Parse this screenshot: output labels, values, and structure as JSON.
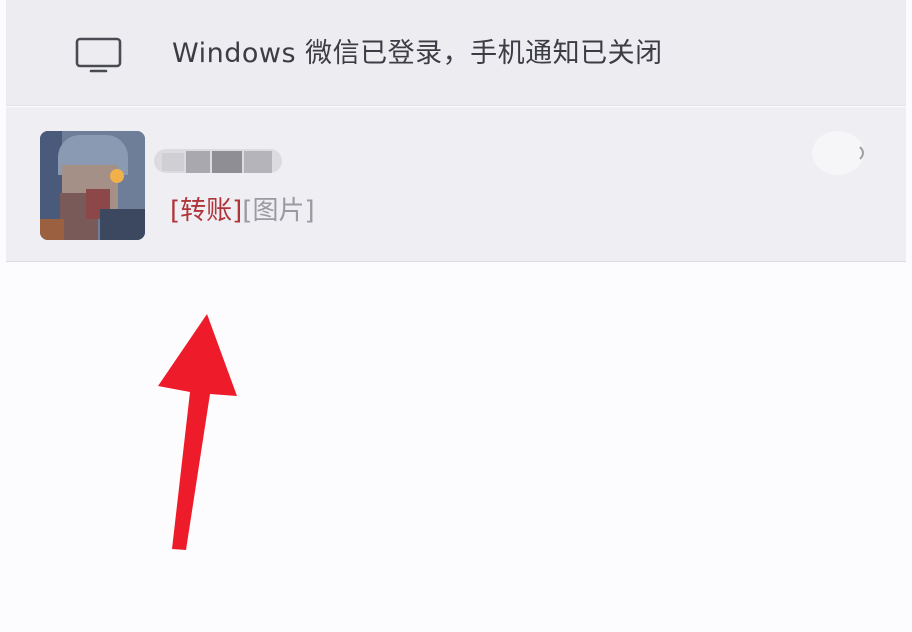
{
  "login_banner": {
    "icon": "monitor-icon",
    "text": "Windows 微信已登录，手机通知已关闭"
  },
  "chat_item": {
    "name": "",
    "preview_tag": "[转账]",
    "preview_text": "[图片]",
    "tag_color": "#b0353b"
  },
  "annotation": {
    "arrow_color": "#ee1c2b",
    "arrow_direction": "up"
  }
}
